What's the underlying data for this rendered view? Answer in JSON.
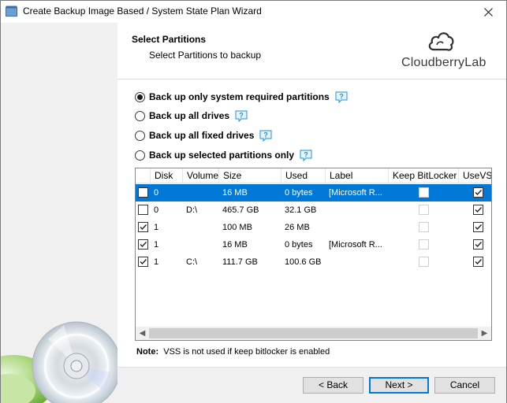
{
  "window": {
    "title": "Create Backup Image Based / System State Plan Wizard"
  },
  "header": {
    "title": "Select Partitions",
    "subtitle": "Select Partitions to backup",
    "brand": "CloudberryLab"
  },
  "options": [
    {
      "label": "Back up only system required partitions",
      "selected": true
    },
    {
      "label": "Back up all drives",
      "selected": false
    },
    {
      "label": "Back up all fixed drives",
      "selected": false
    },
    {
      "label": "Back up selected partitions only",
      "selected": false
    }
  ],
  "table": {
    "columns": [
      "Disk",
      "Volume",
      "Size",
      "Used",
      "Label",
      "Keep BitLocker",
      "UseVSS"
    ],
    "rows": [
      {
        "checked": false,
        "disk": "0",
        "volume": "",
        "size": "16 MB",
        "used": "0 bytes",
        "label": "[Microsoft R...",
        "keep_bitlocker": false,
        "use_vss": true,
        "selected": true
      },
      {
        "checked": false,
        "disk": "0",
        "volume": "D:\\",
        "size": "465.7 GB",
        "used": "32.1 GB",
        "label": "",
        "keep_bitlocker": false,
        "use_vss": true,
        "selected": false
      },
      {
        "checked": true,
        "disk": "1",
        "volume": "",
        "size": "100 MB",
        "used": "26 MB",
        "label": "",
        "keep_bitlocker": false,
        "use_vss": true,
        "selected": false
      },
      {
        "checked": true,
        "disk": "1",
        "volume": "",
        "size": "16 MB",
        "used": "0 bytes",
        "label": "[Microsoft R...",
        "keep_bitlocker": false,
        "use_vss": true,
        "selected": false
      },
      {
        "checked": true,
        "disk": "1",
        "volume": "C:\\",
        "size": "111.7 GB",
        "used": "100.6 GB",
        "label": "",
        "keep_bitlocker": false,
        "use_vss": true,
        "selected": false
      }
    ]
  },
  "note": {
    "prefix": "Note:",
    "text": "VSS is not used if keep bitlocker is enabled"
  },
  "buttons": {
    "back": "< Back",
    "next": "Next >",
    "cancel": "Cancel"
  },
  "colors": {
    "selection": "#0078d7",
    "help_icon": "#1e90d6",
    "sidebar": "#f0f0f0"
  }
}
